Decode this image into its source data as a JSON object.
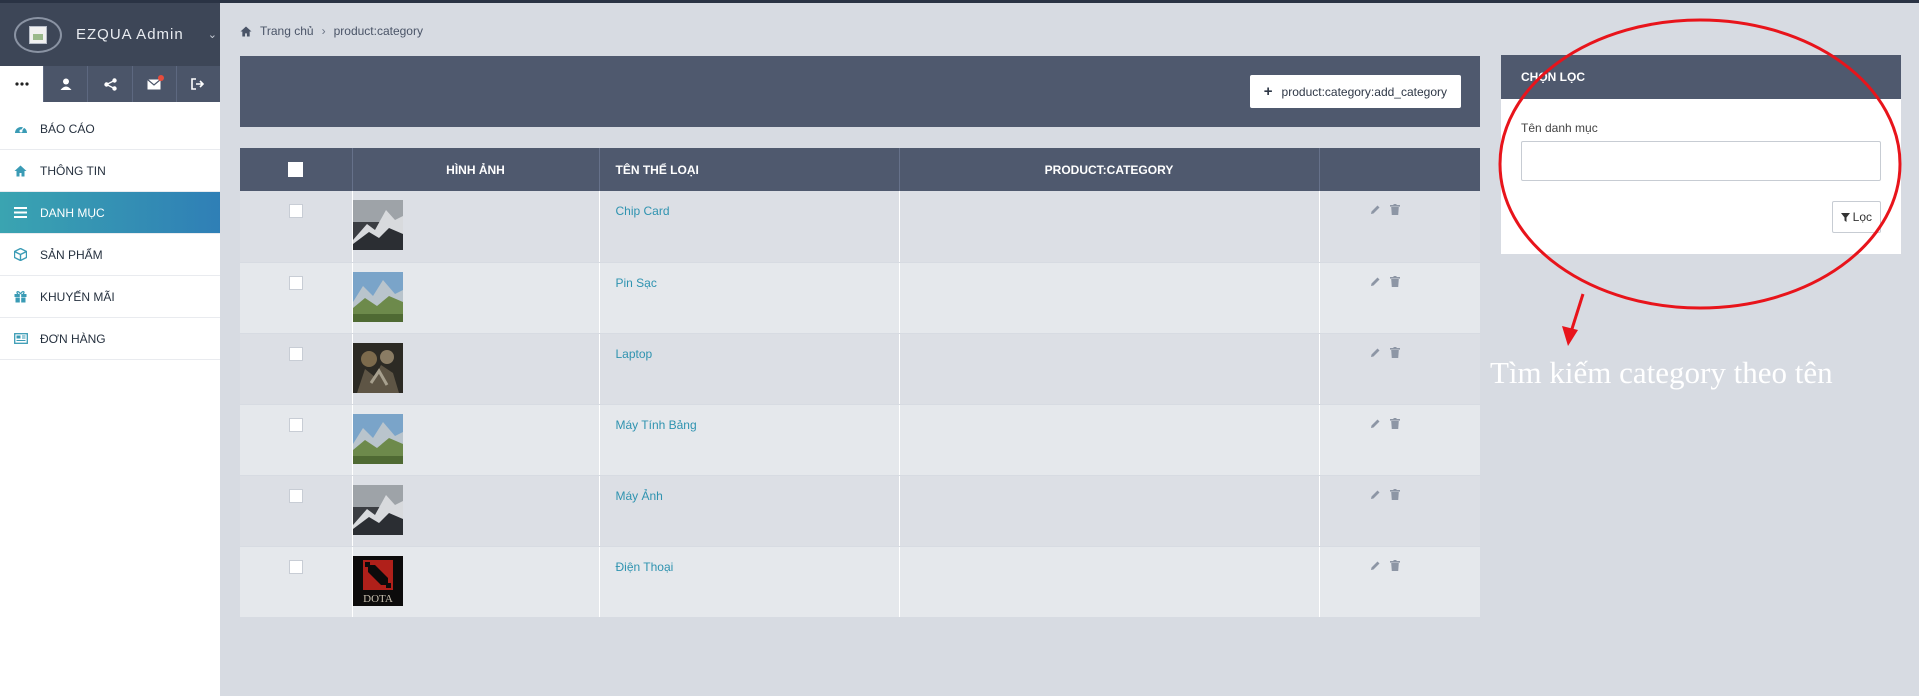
{
  "app": {
    "brand_name": "EZQUA Admin"
  },
  "sidebar": {
    "quick_icons": [
      "more-icon",
      "user-icon",
      "share-icon",
      "mail-icon",
      "logout-icon"
    ],
    "items": [
      {
        "label": "BÁO CÁO",
        "icon": "dashboard-icon"
      },
      {
        "label": "THÔNG TIN",
        "icon": "home-icon"
      },
      {
        "label": "DANH MỤC",
        "icon": "list-icon",
        "active": true
      },
      {
        "label": "SẢN PHẨM",
        "icon": "cube-icon"
      },
      {
        "label": "KHUYẾN MÃI",
        "icon": "gift-icon"
      },
      {
        "label": "ĐƠN HÀNG",
        "icon": "newspaper-icon"
      }
    ]
  },
  "breadcrumb": {
    "home": "Trang chủ",
    "current": "product:category"
  },
  "toolbar": {
    "add_label": "product:category:add_category"
  },
  "table": {
    "headers": [
      "HÌNH ẢNH",
      "TÊN THỂ LOẠI",
      "PRODUCT:CATEGORY"
    ],
    "rows": [
      {
        "name": "Chip Card",
        "image": "mountain-snow"
      },
      {
        "name": "Pin Sạc",
        "image": "mountain-valley"
      },
      {
        "name": "Laptop",
        "image": "warriors"
      },
      {
        "name": "Máy Tính Bảng",
        "image": "mountain-valley"
      },
      {
        "name": "Máy Ảnh",
        "image": "mountain-snow"
      },
      {
        "name": "Điện Thoại",
        "image": "dota-logo"
      }
    ]
  },
  "filter": {
    "title": "CHỌN LỌC",
    "field_label": "Tên danh mục",
    "field_value": "",
    "button_label": "Lọc"
  },
  "annotation": {
    "text": "Tìm kiếm category theo tên",
    "color": "#e8141b"
  }
}
